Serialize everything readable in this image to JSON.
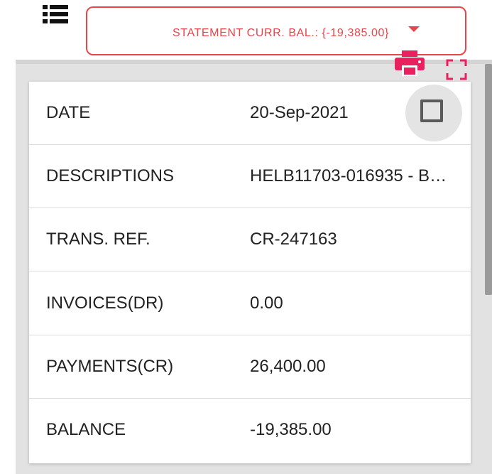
{
  "header": {
    "list_icon": "list-view-icon",
    "balance_dropdown": {
      "label": "STATEMENT CURR. BAL.: {-19,385.00}",
      "caret_icon": "caret-down-icon"
    }
  },
  "toolbar": {
    "print_icon": "print-icon",
    "fullscreen_icon": "fullscreen-icon"
  },
  "record": {
    "rows": [
      {
        "label": "DATE",
        "value": "20-Sep-2021"
      },
      {
        "label": "DESCRIPTIONS",
        "value": "HELB11703-016935 - B…"
      },
      {
        "label": "TRANS. REF.",
        "value": "CR-247163"
      },
      {
        "label": "INVOICES(DR)",
        "value": "0.00"
      },
      {
        "label": "PAYMENTS(CR)",
        "value": "26,400.00"
      },
      {
        "label": "BALANCE",
        "value": "-19,385.00"
      }
    ],
    "select_checkbox": {
      "checked": false,
      "icon": "checkbox-icon"
    }
  },
  "colors": {
    "accent": "#e8444a",
    "print": "#e8215f",
    "panel_bg": "#e2e2e2"
  }
}
